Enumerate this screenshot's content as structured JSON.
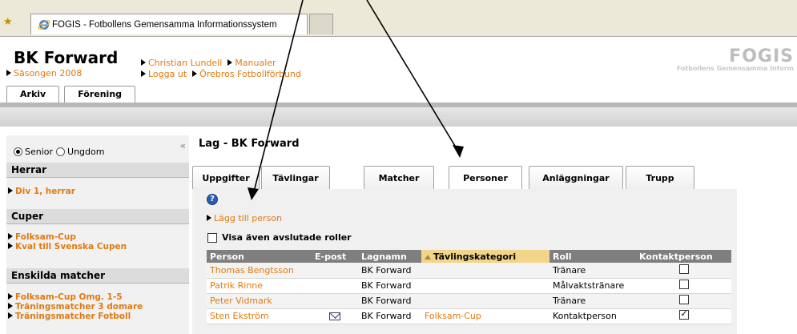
{
  "browser": {
    "tab_title": "FOGIS - Fotbollens Gemensamma Informationssystem"
  },
  "header": {
    "club_name": "BK Forward",
    "season": "Säsongen 2008",
    "links": [
      "Christian Lundell",
      "Manualer",
      "Logga ut",
      "Örebros Fotbollförbund"
    ],
    "logo_title": "FOGIS",
    "logo_subtitle": "Fotbollens Gemensamma Inform",
    "main_tabs": [
      "Arkiv",
      "Förening"
    ]
  },
  "sidebar": {
    "radio_senior": "Senior",
    "radio_youth": "Ungdom",
    "collapse_label": "«",
    "sections": [
      {
        "title": "Herrar",
        "items": [
          "Div 1, herrar"
        ]
      },
      {
        "title": "Cuper",
        "items": [
          "Folksam-Cup",
          "Kval till Svenska Cupen"
        ]
      },
      {
        "title": "Enskilda matcher",
        "items": [
          "Folksam-Cup Omg. 1-5",
          "Träningsmatcher 3 domare",
          "Träningsmatcher Fotboll"
        ]
      }
    ]
  },
  "main": {
    "title": "Lag - BK Forward",
    "tabs": [
      "Uppgifter",
      "Tävlingar",
      "Matcher",
      "Personer",
      "Anläggningar",
      "Trupp"
    ],
    "active_tab": "Personer",
    "help_label": "?",
    "add_person": "Lägg till person",
    "show_ended_roles": "Visa även avslutade roller",
    "table": {
      "columns": [
        "Person",
        "E-post",
        "Lagnamn",
        "Tävlingskategori",
        "Roll",
        "Kontaktperson"
      ],
      "rows": [
        {
          "person": "Thomas Bengtsson",
          "team": "BK Forward",
          "category": "",
          "role": "Tränare",
          "contact": false
        },
        {
          "person": "Patrik Rinne",
          "team": "BK Forward",
          "category": "",
          "role": "Målvaktstränare",
          "contact": false
        },
        {
          "person": "Peter Vidmark",
          "team": "BK Forward",
          "category": "",
          "role": "Tränare",
          "contact": false
        },
        {
          "person": "Sten Ekström",
          "email_icon": "mail-icon",
          "team": "BK Forward",
          "category": "Folksam-Cup",
          "role": "Kontaktperson",
          "contact": true
        }
      ]
    }
  }
}
